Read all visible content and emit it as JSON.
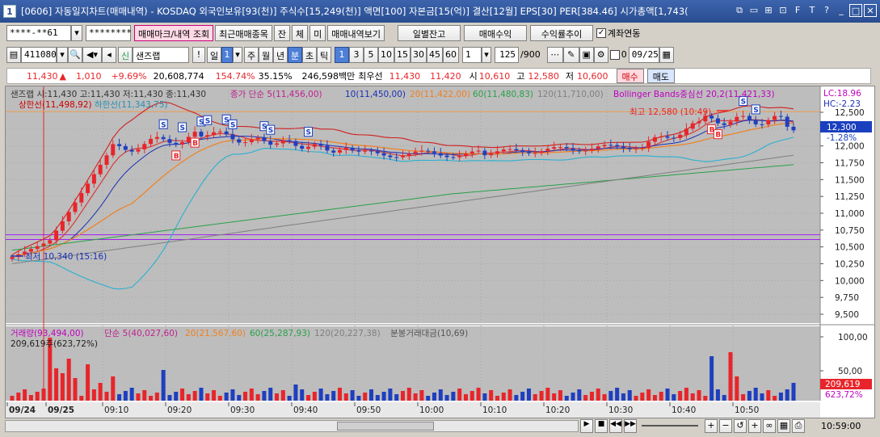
{
  "window": {
    "number": "1",
    "title": "[0606] 자동일지차트(매매내역) - KOSDAQ 외국인보유[93(천)] 주식수[15,249(천)] 액면[100] 자본금[15(억)] 결산[12월] EPS[30] PER[384.46] 시가총액[1,743("
  },
  "toolbar1": {
    "account": "****-**61",
    "password": "********",
    "buttons": [
      "매매마크/내역 조회",
      "최근매매종목",
      "잔",
      "체",
      "미",
      "매매내역보기"
    ],
    "right_buttons": [
      "일별잔고",
      "매매수익",
      "수익률추이"
    ],
    "checkbox_label": "계좌연동"
  },
  "toolbar2": {
    "code": "411080",
    "name": "샌즈랩",
    "period_buttons": [
      "일",
      "주",
      "월",
      "년",
      "분",
      "초",
      "틱"
    ],
    "selected_period": "1",
    "minutes": [
      "1",
      "3",
      "5",
      "10",
      "15",
      "30",
      "45",
      "60"
    ],
    "count_value": "1",
    "range": "125",
    "range_total": "/900",
    "zero_value": "0",
    "date": "09/25"
  },
  "quote": {
    "price": "11,430",
    "change": "1,010",
    "change_pct": "+9.69%",
    "volume": "20,608,774",
    "pct1": "154.74%",
    "pct2": "35.15%",
    "amount": "246,598백만",
    "best_label": "최우선",
    "best_ask": "11,430",
    "best_bid": "11,420",
    "open_label": "시",
    "open": "10,610",
    "high_label": "고",
    "high": "12,580",
    "low_label": "저",
    "low": "10,600",
    "buy": "매수",
    "sell": "매도"
  },
  "price_panel": {
    "ohlc_legend": "샌즈랩 시:11,430 고:11,430 저:11,430 종:11,430",
    "ma_legend": [
      "종가 단순 5(11,456,00)",
      "10(11,450,00)",
      "20(11,422,00)",
      "60(11,480,83)",
      "120(11,710,00)"
    ],
    "bb_legend": "Bollinger Bands중심선 20,2(11,421,33)",
    "upper_limit_label": "상한선(11,498,92)",
    "lower_limit_label": "하한선(11,343,75)",
    "lc": "LC:18.96",
    "hc": "HC:-2.23",
    "current_price": "12,300",
    "current_pct": "-1.28%",
    "high_annot": "최고 12,580 (10:49)",
    "low_annot": "최저 10,340 (15:16)",
    "y_ticks": [
      "12,500",
      "12,250",
      "12,000",
      "11,750",
      "11,500",
      "11,250",
      "11,000",
      "10,750",
      "10,500",
      "10,250",
      "10,000",
      "9,750",
      "9,500"
    ]
  },
  "volume_panel": {
    "legend": [
      "거래량(93,494,00)",
      "단순 5(40,027,60)",
      "20(21,567,60)",
      "60(25,287,93)",
      "120(20,227,38)",
      "분봉거래대금(10,69)"
    ],
    "sub_legend": "209,619주(623,72%)",
    "y_ticks": [
      "100,00",
      "50,00"
    ],
    "current_vol": "209,619",
    "current_vol_pct": "623,72%"
  },
  "x_axis": {
    "labels": [
      "09/24",
      "09/25",
      "09:10",
      "09:20",
      "09:30",
      "09:40",
      "09:50",
      "10:00",
      "10:10",
      "10:20",
      "10:30",
      "10:40",
      "10:50"
    ],
    "time_readout": "10:59:00"
  },
  "colors": {
    "up": "#e8252a",
    "down": "#1e3fbf",
    "ma5": "#d63b3b",
    "ma10": "#1a2fb4",
    "ma20": "#f08020",
    "ma60": "#29a04a",
    "ma120": "#7f7f7f",
    "bb": "#29b0d0",
    "purple": "#a020f0"
  }
}
